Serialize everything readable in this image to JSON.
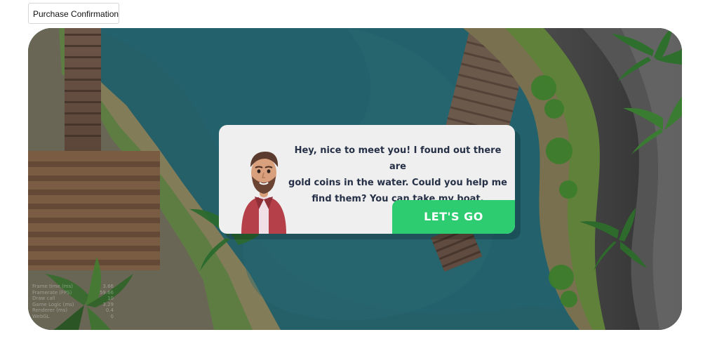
{
  "top_button": {
    "label": "Purchase Confirmation"
  },
  "dialog": {
    "message": "Hey, nice to meet you! I found out there are\ngold coins in the water. Could you help me\nfind them? You can take my boat.",
    "action_label": "LET'S GO"
  },
  "stats": [
    {
      "label": "Frame time (ms)",
      "value": "3.66"
    },
    {
      "label": "Framerate (FPS)",
      "value": "59.66"
    },
    {
      "label": "Draw call",
      "value": "10"
    },
    {
      "label": "Game Logic (ms)",
      "value": "3.29"
    },
    {
      "label": "Renderer (ms)",
      "value": "0.4"
    },
    {
      "label": "WebGL",
      "value": "0"
    }
  ],
  "theme": {
    "button_green": "#2ecc71",
    "dialog_bg": "#efefef",
    "text_navy": "#263046",
    "water_deep": "#1f5d66"
  },
  "icons": {
    "character": "bearded-man-avatar-icon"
  }
}
